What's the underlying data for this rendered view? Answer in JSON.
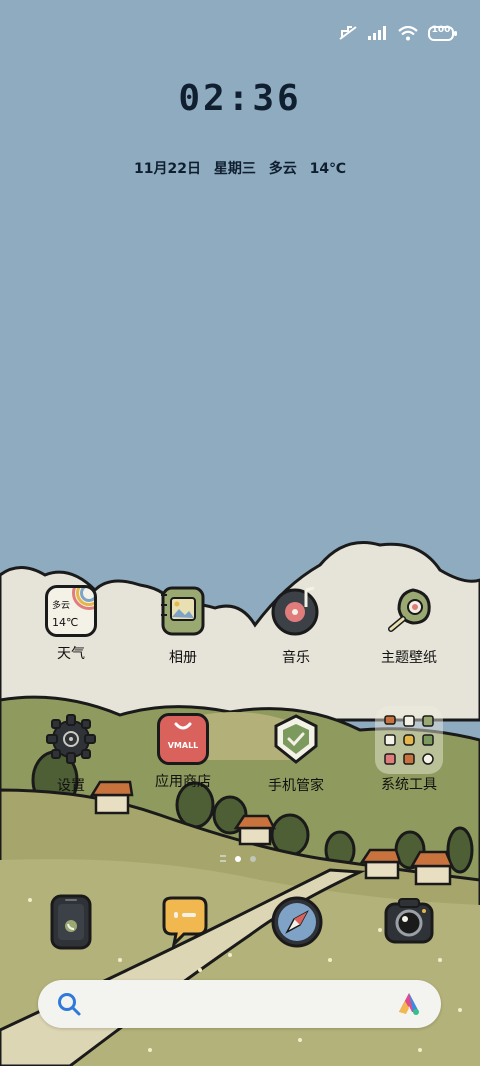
{
  "status_bar": {
    "icons": [
      "mute-icon",
      "cellular-signal-icon",
      "wifi-icon",
      "battery-icon"
    ],
    "battery": "100"
  },
  "lock": {
    "time": "02:36",
    "date": "11月22日",
    "weekday": "星期三",
    "weather": "多云",
    "temperature": "14℃"
  },
  "weather_widget": {
    "condition": "多云",
    "temperature": "14℃"
  },
  "apps_row1": [
    {
      "label": "天气",
      "icon": "weather-icon"
    },
    {
      "label": "相册",
      "icon": "gallery-icon"
    },
    {
      "label": "音乐",
      "icon": "music-icon"
    },
    {
      "label": "主题壁纸",
      "icon": "theme-icon"
    }
  ],
  "apps_row2": [
    {
      "label": "设置",
      "icon": "settings-gear-icon"
    },
    {
      "label": "应用商店",
      "icon": "app-store-icon",
      "badge_text": "VMALL"
    },
    {
      "label": "手机管家",
      "icon": "phone-manager-shield-icon"
    },
    {
      "label": "系统工具",
      "icon": "system-tools-folder-icon"
    }
  ],
  "page_indicator": {
    "pages": 2,
    "current": 1
  },
  "dock": [
    "phone-icon",
    "messages-icon",
    "browser-compass-icon",
    "camera-icon"
  ],
  "search": {
    "icons": [
      "search-icon",
      "celia-assistant-icon"
    ]
  },
  "colors": {
    "sky": "#8fabc0",
    "cloud": "#e6e3d8",
    "hill": "#a6a66c",
    "hill_dark": "#6d7d4a",
    "ink": "#1a1a1a"
  }
}
